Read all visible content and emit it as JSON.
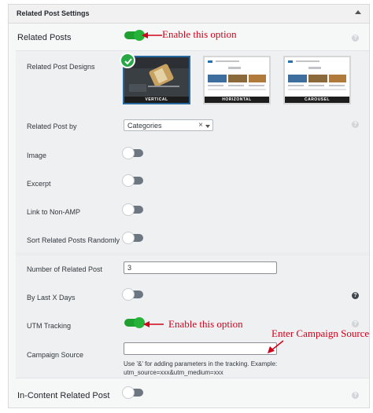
{
  "panel": {
    "title": "Related Post Settings"
  },
  "related_posts": {
    "label": "Related Posts",
    "enabled": true
  },
  "designs": {
    "label": "Related Post Designs",
    "options": [
      {
        "caption": "VERTICAL",
        "selected": true
      },
      {
        "caption": "HORIZONTAL",
        "selected": false
      },
      {
        "caption": "CAROUSEL",
        "selected": false
      }
    ]
  },
  "related_by": {
    "label": "Related Post by",
    "value": "Categories",
    "clear": "×"
  },
  "image": {
    "label": "Image",
    "enabled": false
  },
  "excerpt": {
    "label": "Excerpt",
    "enabled": false
  },
  "link_non_amp": {
    "label": "Link to Non-AMP",
    "enabled": false
  },
  "sort_random": {
    "label": "Sort Related Posts Randomly",
    "enabled": false
  },
  "number_of_posts": {
    "label": "Number of Related Post",
    "value": "3"
  },
  "by_last_days": {
    "label": "By Last X Days",
    "enabled": false
  },
  "utm_tracking": {
    "label": "UTM Tracking",
    "enabled": true
  },
  "campaign_source": {
    "label": "Campaign Source",
    "value": "",
    "note_line1": "Use '&' for adding parameters in the tracking. Example:",
    "note_line2": "utm_source=xxx&utm_medium=xxx"
  },
  "in_content": {
    "label": "In-Content Related Post",
    "enabled": false
  },
  "help_icon": "?",
  "annotations": {
    "enable_1": "Enable this option",
    "enable_2": "Enable this option",
    "campaign": "Enter Campaign Source"
  },
  "colors": {
    "toggle_on": "#1e9f2f",
    "toggle_off": "#6c7781",
    "annotation": "#d0021b",
    "selected_border": "#27699e"
  }
}
